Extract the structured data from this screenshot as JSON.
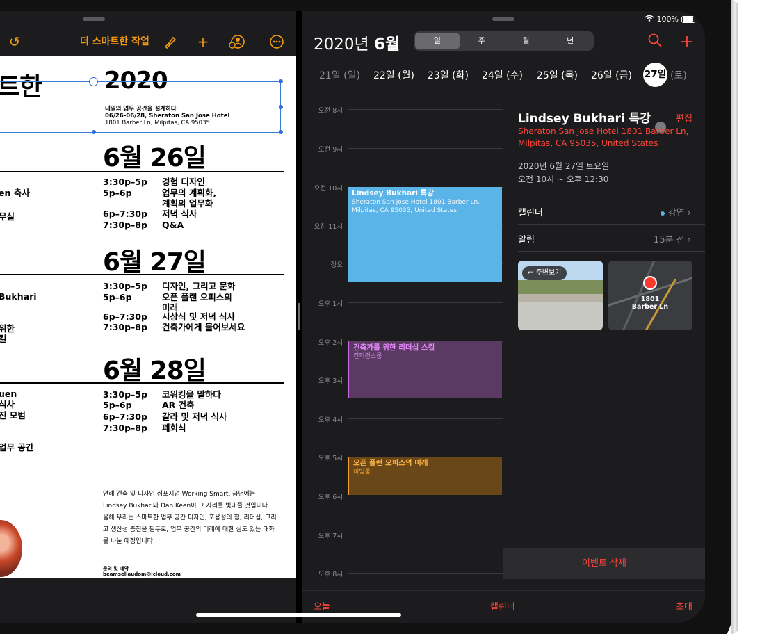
{
  "pages": {
    "toolbar_title": "더 스마트한 작업",
    "heading_fragment": "트한",
    "title_year": "2020",
    "subtitle_line1": "내일의 업무 공간을 설계하다",
    "subtitle_line2": "06/26-06/28, Sheraton San Jose Hotel",
    "subtitle_line3": "1801 Barber Ln, Milpitas, CA 95035",
    "days": [
      {
        "heading": "6월 26일",
        "times": [
          "3:30p–5p",
          "5p–6p",
          "",
          "6p–7:30p",
          "7:30p–8p"
        ],
        "sessions": [
          "경험 디자인",
          "업무의 계획화,",
          "계획의 업무화",
          "저녁 식사",
          "Q&A"
        ],
        "left_fragments": [
          "en 축사",
          "무실"
        ]
      },
      {
        "heading": "6월 27일",
        "times": [
          "3:30p–5p",
          "5p–6p",
          "",
          "6p–7:30p",
          "7:30p–8p"
        ],
        "sessions": [
          "디자인, 그리고 문화",
          "오픈 플랜 오피스의",
          "미래",
          "시상식 및 저녁 식사",
          "건축가에게 물어보세요"
        ],
        "left_fragments": [
          "Bukhari",
          "위한",
          "킬"
        ]
      },
      {
        "heading": "6월 28일",
        "times": [
          "3:30p–5p",
          "5p–6p",
          "6p–7:30p",
          "7:30p–8p"
        ],
        "sessions": [
          "코워킹을 말하다",
          "AR 건축",
          "갈라 및 저녁 식사",
          "폐회식"
        ],
        "left_fragments": [
          "uen",
          "식사",
          "진 모범",
          "업무 공간"
        ]
      }
    ],
    "paragraph": "연례 건축 및 디자인 심포지엄 Working Smart. 금년에는 Lindsey Bukhari와 Dan Keen이 그 자리를 빛내줄 것입니다. 올해 우리는 스마트한 업무 공간 디자인, 포용성의 힘, 리더십, 그리고 생산성 증진을 필두로, 업무 공간의 미래에 대한 심도 있는 대화를 나눌 예정입니다.",
    "contact_label": "문의 및 예약",
    "contact_email": "beamsellaudom@icloud.com"
  },
  "calendar": {
    "status_battery": "100%",
    "month_title_year": "2020년",
    "month_title_month": "6월",
    "view_tabs": [
      "일",
      "주",
      "월",
      "년"
    ],
    "active_tab_index": 0,
    "weekdays": [
      "21일 (일)",
      "22일 (월)",
      "23일 (화)",
      "24일 (수)",
      "25일 (목)",
      "26일 (금)"
    ],
    "selected_day": "27일",
    "selected_day_suffix": "(토)",
    "hours": [
      "오전 8시",
      "오전 9시",
      "오전 10시",
      "오전 11시",
      "정오",
      "오후 1시",
      "오후 2시",
      "오후 3시",
      "오후 4시",
      "오후 5시",
      "오후 6시",
      "오후 7시",
      "오후 8시"
    ],
    "events": [
      {
        "title": "Lindsey Bukhari 특강",
        "subtitle": "Sheraton San Jose Hotel 1801 Barber Ln, Milpitas, CA 95035, United States",
        "color": "#5ab4e8"
      },
      {
        "title": "건축가를 위한 리더십 스킬",
        "subtitle": "컨퍼런스룸",
        "color": "#d168e9"
      },
      {
        "title": "오픈 플랜 오피스의 미래",
        "subtitle": "미팅룸",
        "color": "#f0a02e"
      }
    ],
    "detail": {
      "title": "Lindsey Bukhari 특강",
      "edit_label": "편집",
      "location": "Sheraton San Jose Hotel 1801 Barber Ln, Milpitas, CA 95035, United States",
      "date_line": "2020년 6월 27일 토요일",
      "time_line": "오전 10시 ~ 오후 12:30",
      "calendar_label": "캘린더",
      "calendar_value": "강연",
      "alert_label": "알림",
      "alert_value": "15분 전",
      "lookaround_label": "주변보기",
      "map_label": "1801 Barber Ln",
      "delete_label": "이벤트 삭제"
    },
    "bottom_bar": {
      "today": "오늘",
      "calendars": "캘린더",
      "inbox": "초대"
    },
    "accent_color": "#ff453a"
  }
}
